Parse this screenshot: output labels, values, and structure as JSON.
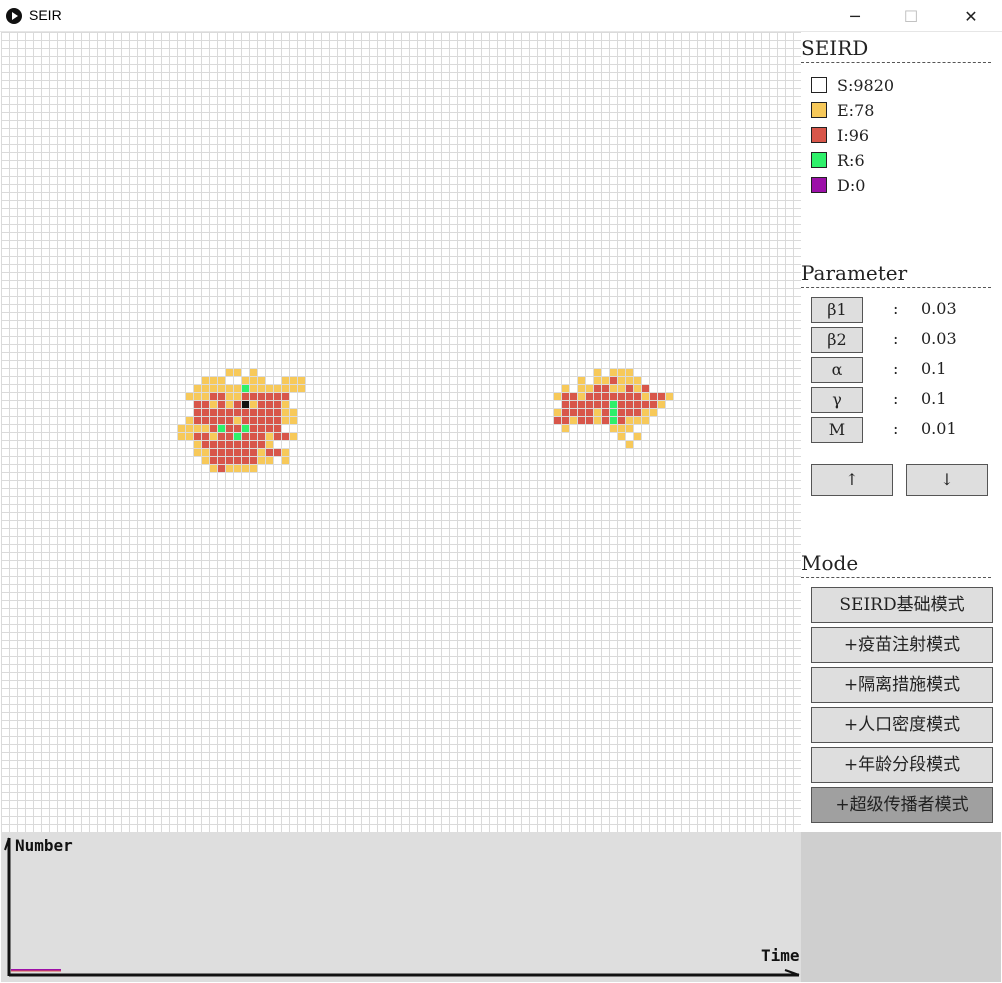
{
  "window": {
    "title": "SEIR",
    "minimize_glyph": "─",
    "maximize_glyph": "☐",
    "close_glyph": "✕"
  },
  "colors": {
    "S": "#ffffff",
    "E": "#f7c95a",
    "I": "#d8564a",
    "R": "#2ef06a",
    "D": "#9c10a8",
    "superspreader": "#111111"
  },
  "legend": {
    "title": "SEIRD",
    "items": [
      {
        "key": "S",
        "label": "S:9820",
        "color": "#ffffff"
      },
      {
        "key": "E",
        "label": "E:78",
        "color": "#f7c95a"
      },
      {
        "key": "I",
        "label": "I:96",
        "color": "#d8564a"
      },
      {
        "key": "R",
        "label": "R:6",
        "color": "#2ef06a"
      },
      {
        "key": "D",
        "label": "D:0",
        "color": "#9c10a8"
      }
    ]
  },
  "parameters": {
    "title": "Parameter",
    "items": [
      {
        "name": "β1",
        "colon": ":",
        "value": "0.03"
      },
      {
        "name": "β2",
        "colon": ":",
        "value": "0.03"
      },
      {
        "name": "α",
        "colon": ":",
        "value": "0.1"
      },
      {
        "name": "γ",
        "colon": ":",
        "value": "0.1"
      },
      {
        "name": "M",
        "colon": ":",
        "value": "0.01"
      }
    ],
    "up_label": "↑",
    "down_label": "↓"
  },
  "mode": {
    "title": "Mode",
    "buttons": [
      {
        "label": "SEIRD基础模式",
        "active": false
      },
      {
        "label": "+疫苗注射模式",
        "active": false
      },
      {
        "label": "+隔离措施模式",
        "active": false
      },
      {
        "label": "+人口密度模式",
        "active": false
      },
      {
        "label": "+年龄分段模式",
        "active": false
      },
      {
        "label": "+超级传播者模式",
        "active": true
      }
    ]
  },
  "chart": {
    "y_label": "Number",
    "x_label": "Time"
  },
  "grid": {
    "cluster1": {
      "E": "........EE.E........|...EEE..EEE..EEE...|..EEEEEEREEEEEEE...|...EEEIIEEIIIIII....|....IIEIEIXEIIIE....|....IIIIIIIIIIIEE...|...EIIIIIEIIIIIEE...|..EEEEIRIIRIIII.....|..EEIIEIIRIIIEIIE...|....EIIIIIIIIE......|....EEIIIIIIEIIE....|.....EIIIIIIEE.E....|......EIEEEE........",
      "note": ""
    }
  }
}
